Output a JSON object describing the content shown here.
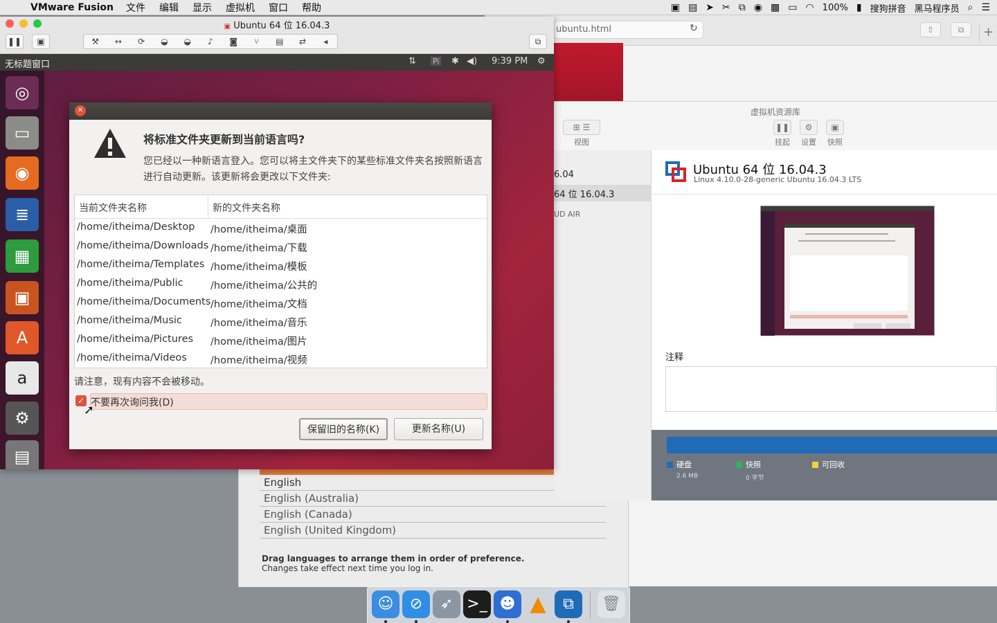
{
  "menubar": {
    "app_name": "VMware Fusion",
    "items": [
      "文件",
      "编辑",
      "显示",
      "虚拟机",
      "窗口",
      "帮助"
    ],
    "battery": "100%",
    "input_method": "搜狗拼音",
    "user": "黑马程序员"
  },
  "browser": {
    "url": "ubuntu.html"
  },
  "language_panel": {
    "languages": [
      "English",
      "English (Australia)",
      "English (Canada)",
      "English (United Kingdom)"
    ],
    "note_bold": "Drag languages to arrange them in order of preference.",
    "note": "Changes take effect next time you log in."
  },
  "library": {
    "title": "虚拟机资源库",
    "tools": {
      "view": "视图",
      "suspend": "挂起",
      "settings": "设置",
      "snapshot": "快照"
    },
    "sidebar": {
      "item1": "6.04",
      "item2": "64 位 16.04.3",
      "item3": "UD AIR"
    },
    "vm_name": "Ubuntu 64 位 16.04.3",
    "vm_os": "Linux 4.10.0-28-generic Ubuntu 16.04.3 LTS",
    "notes_label": "注释",
    "storage": {
      "disk_label": "硬盘",
      "disk_size": "2.6 MB",
      "snapshot_label": "快照",
      "snapshot_size": "0 字节",
      "reclaim_label": "可回收",
      "colors": {
        "disk": "#1f6bb8",
        "snapshot": "#2fb35c",
        "reclaim": "#f3d23b"
      }
    }
  },
  "vm_window": {
    "title": "Ubuntu 64 位 16.04.3",
    "guest_panel": {
      "window_title": "无标题窗口",
      "kbd": "Pi",
      "time": "9:39 PM"
    }
  },
  "dialog": {
    "heading": "将标准文件夹更新到当前语言吗?",
    "message": "您已经以一种新语言登入。您可以将主文件夹下的某些标准文件夹名按照新语言进行自动更新。该更新将会更改以下文件夹:",
    "col_current": "当前文件夹名称",
    "col_new": "新的文件夹名称",
    "rows": [
      {
        "current": "/home/itheima/Desktop",
        "new": "/home/itheima/桌面"
      },
      {
        "current": "/home/itheima/Downloads",
        "new": "/home/itheima/下载"
      },
      {
        "current": "/home/itheima/Templates",
        "new": "/home/itheima/模板"
      },
      {
        "current": "/home/itheima/Public",
        "new": "/home/itheima/公共的"
      },
      {
        "current": "/home/itheima/Documents",
        "new": "/home/itheima/文档"
      },
      {
        "current": "/home/itheima/Music",
        "new": "/home/itheima/音乐"
      },
      {
        "current": "/home/itheima/Pictures",
        "new": "/home/itheima/图片"
      },
      {
        "current": "/home/itheima/Videos",
        "new": "/home/itheima/视频"
      }
    ],
    "note": "请注意，现有内容不会被移动。",
    "dont_ask": "不要再次询问我(D)",
    "dont_ask_checked": true,
    "keep_button": "保留旧的名称(K)",
    "update_button": "更新名称(U)"
  }
}
